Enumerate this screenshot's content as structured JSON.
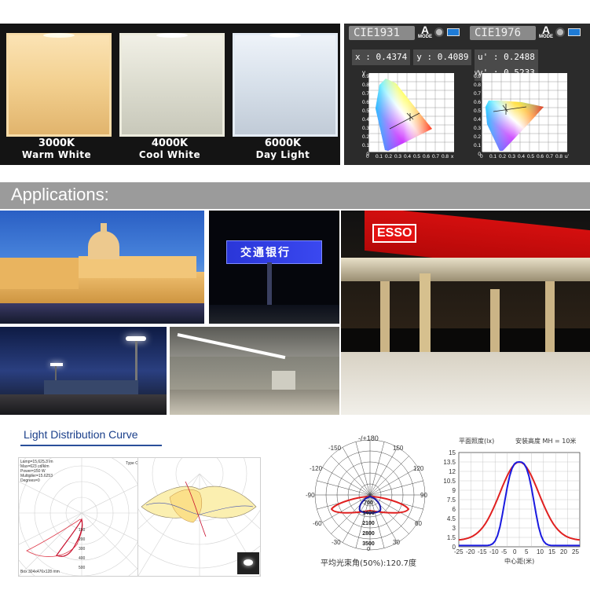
{
  "color_temps": [
    {
      "temp": "3000K",
      "name": "Warm White"
    },
    {
      "temp": "4000K",
      "name": "Cool White"
    },
    {
      "temp": "6000K",
      "name": "Day Light"
    }
  ],
  "cie": {
    "left": {
      "title": "CIE1931",
      "mode": "MODE",
      "x_label": "x : 0.4374",
      "y_label": "y : 0.4089",
      "x_axis": "x",
      "y_axis": "y",
      "ticks": [
        "0",
        "0.1",
        "0.2",
        "0.3",
        "0.4",
        "0.5",
        "0.6",
        "0.7",
        "0.8"
      ],
      "yticks": [
        "0.9",
        "0.8",
        "0.7",
        "0.6",
        "0.5",
        "0.4",
        "0.3",
        "0.2",
        "0.1",
        "0"
      ]
    },
    "right": {
      "title": "CIE1976",
      "mode": "MODE",
      "x_label": "u' : 0.2488",
      "y_label": "v' : 0.5233",
      "x_axis": "u'",
      "y_axis": "v'",
      "ticks": [
        "0",
        "0.1",
        "0.2",
        "0.3",
        "0.4",
        "0.5",
        "0.6",
        "0.7",
        "0.8"
      ],
      "yticks": [
        "0.9",
        "0.8",
        "0.7",
        "0.6",
        "0.5",
        "0.4",
        "0.3",
        "0.2",
        "0.1",
        "0"
      ]
    }
  },
  "applications": {
    "title": "Applications:",
    "billboard_text": "交通银行",
    "esso_text": "ESSO"
  },
  "ldc": {
    "title": "Light Distribution Curve",
    "info_lines": [
      "Lamp=15,625.3 lm",
      "Max=623 cd/klm",
      "Power=150 W",
      "Multiplier=15.6253",
      "Degrees=0"
    ],
    "type_label": "Type C",
    "box_label": "Box 304x476x128 mm",
    "left_scale": [
      "100",
      "200",
      "300",
      "400",
      "500"
    ],
    "polar": {
      "top_label": "-/+180",
      "angles": [
        "-150",
        "150",
        "-120",
        "120",
        "-90",
        "90",
        "-60",
        "60",
        "-30",
        "30",
        "0"
      ],
      "radii": [
        "700",
        "1400",
        "2100",
        "2800",
        "3500"
      ],
      "beam_caption": "平均光束角(50%):120.7度"
    },
    "illum": {
      "ylabel": "平面照度(lx)",
      "height_label": "安装高度 MH = 10米",
      "yticks": [
        "15",
        "13.5",
        "12",
        "10.5",
        "9",
        "7.5",
        "6",
        "4.5",
        "3",
        "1.5",
        "0"
      ],
      "xticks": [
        "-25",
        "-20",
        "-15",
        "-10",
        "-5",
        "0",
        "5",
        "10",
        "15",
        "20",
        "25"
      ],
      "xlabel": "中心距(米)"
    }
  }
}
